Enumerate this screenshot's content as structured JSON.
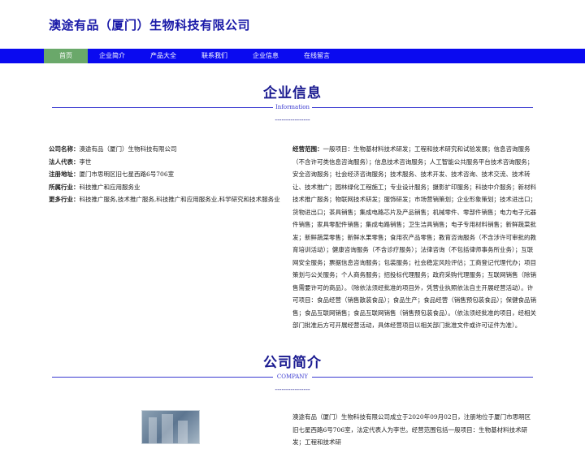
{
  "header": {
    "site_title": "澳途有品（厦门）生物科技有限公司"
  },
  "nav": {
    "items": [
      {
        "label": "首页",
        "active": true
      },
      {
        "label": "企业简介",
        "active": false
      },
      {
        "label": "产品大全",
        "active": false
      },
      {
        "label": "联系我们",
        "active": false
      },
      {
        "label": "企业信息",
        "active": false
      },
      {
        "label": "在线留言",
        "active": false
      }
    ]
  },
  "company_info": {
    "title": "企业信息",
    "subtitle": "Information",
    "dashes": "----------------",
    "fields": [
      {
        "label": "公司名称：",
        "value": "澳途有品（厦门）生物科技有限公司"
      },
      {
        "label": "法人代表：",
        "value": "李世"
      },
      {
        "label": "注册地址：",
        "value": "厦门市思明区旧七星西路6号706室"
      },
      {
        "label": "所属行业：",
        "value": "科技推广和应用服务业"
      },
      {
        "label": "更多行业：",
        "value": "科技推广服务,技术推广服务,科技推广和应用服务业,科学研究和技术服务业"
      }
    ],
    "scope_label": "经营范围：",
    "scope_value": "一般项目：生物基材料技术研发；工程和技术研究和试验发展；信息咨询服务（不含许可类信息咨询服务）；信息技术咨询服务；人工智能公共服务平台技术咨询服务；安全咨询服务；社会经济咨询服务；技术服务、技术开发、技术咨询、技术交流、技术转让、技术推广；园林绿化工程施工；专业设计服务；摄影扩印服务；科技中介服务；新材料技术推广服务；物联网技术研发；服饰研发；市场营销策划；企业形象策划；技术进出口；货物进出口；茶具销售；集成电路芯片及产品销售；机械零件、零部件销售；电力电子元器件销售；家具零配件销售；集成电路销售；卫生洁具销售；电子专用材料销售；新鲜蔬菜批发；新鲜蔬菜零售；新鲜水果零售；食用农产品零售；教育咨询服务（不含涉许可审批的教育培训活动）；健康咨询服务（不含诊疗服务）；法律咨询（不包括律师事务所业务）；互联网安全服务；票据信息咨询服务；包装服务；社会稳定风险评估；工商登记代理代办；项目策划与公关服务；个人商务服务；招投标代理服务；政府采购代理服务；互联网销售（除销售需要许可的商品）。（除依法须经批准的项目外，凭营业执照依法自主开展经营活动）。许可项目：食品经营（销售散装食品）；食品生产；食品经营（销售预包装食品）；保健食品销售；食品互联网销售；食品互联网销售（销售预包装食品）。（依法须经批准的项目，经相关部门批准后方可开展经营活动，具体经营项目以相关部门批准文件或许可证件为准）。"
  },
  "company_intro": {
    "title": "公司简介",
    "subtitle": "COMPANY",
    "dashes": "----------------",
    "text": "澳途有品（厦门）生物科技有限公司成立于2020年09月02日，注册地位于厦门市思明区旧七星西路6号706室，法定代表人为李世。经营范围包括一般项目：生物基材料技术研发；工程和技术研"
  }
}
